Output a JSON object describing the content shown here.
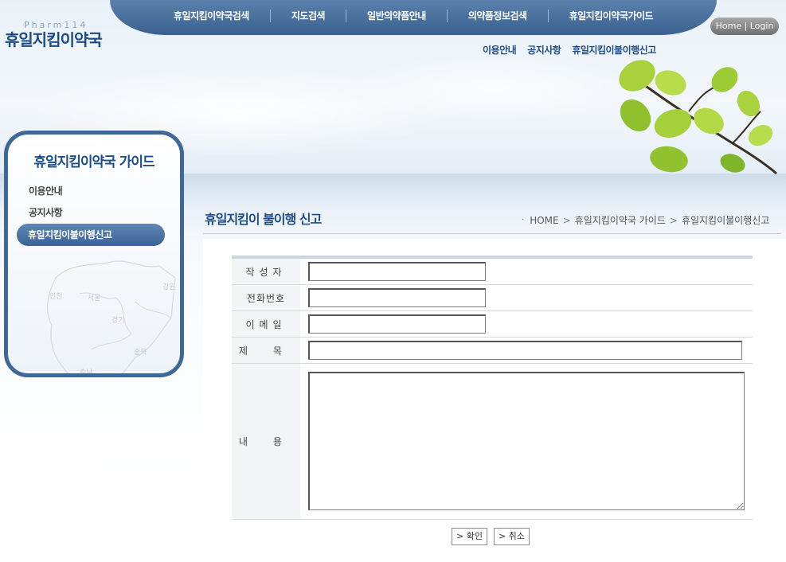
{
  "logo": {
    "sub": "Pharm114",
    "main": "휴일지킴이약국"
  },
  "top_nav": [
    {
      "label": "휴일지킴이약국검색"
    },
    {
      "label": "지도검색"
    },
    {
      "label": "일반의약품안내"
    },
    {
      "label": "의약품정보검색"
    },
    {
      "label": "휴일지킴이약국가이드"
    }
  ],
  "home_login": "Home | Login",
  "sub_nav": [
    {
      "label": "이용안내"
    },
    {
      "label": "공지사항"
    },
    {
      "label": "휴일지킴이불이행신고"
    }
  ],
  "sidebar": {
    "title": "휴일지킴이약국 가이드",
    "items": [
      {
        "label": "이용안내"
      },
      {
        "label": "공지사항"
      },
      {
        "label": "휴일지킴이불이행신고"
      }
    ],
    "map_labels": [
      "인천",
      "서울",
      "강원",
      "경기",
      "충북",
      "충남"
    ]
  },
  "page": {
    "title": "휴일지킴이 불이행 신고",
    "breadcrumb": [
      "HOME",
      "휴일지킴이약국 가이드",
      "휴일지킴이불이행신고"
    ],
    "breadcrumb_sep": ">",
    "breadcrumb_dot": "·"
  },
  "form": {
    "author_label": "작성자",
    "phone_label": "전화번호",
    "email_label": "이메일",
    "subject_label": "제 목",
    "content_label": "내 용",
    "author_value": "",
    "phone_value": "",
    "email_value": "",
    "subject_value": "",
    "content_value": ""
  },
  "buttons": {
    "confirm": "> 확인",
    "cancel": "> 취소"
  },
  "colors": {
    "brand": "#1e4b86",
    "nav": "#3f6797",
    "leaf": "#9dc83a"
  }
}
